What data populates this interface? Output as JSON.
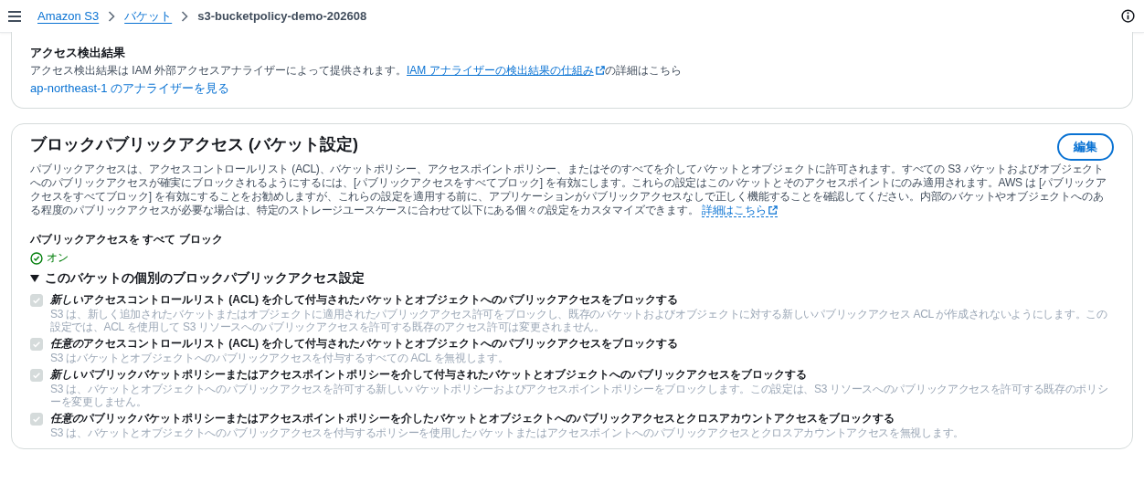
{
  "top_bar": {
    "breadcrumbs": [
      {
        "label": "Amazon S3",
        "link": true
      },
      {
        "label": "バケット",
        "link": true
      },
      {
        "label": "s3-bucketpolicy-demo-202608",
        "link": false
      }
    ]
  },
  "access_findings": {
    "title": "アクセス検出結果",
    "text_before": "アクセス検出結果は IAM 外部アクセスアナライザーによって提供されます。",
    "link": "IAM アナライザーの検出結果の仕組み",
    "text_after": "の詳細はこちら",
    "analyzer_link": "ap-northeast-1 のアナライザーを見る"
  },
  "block_public_access": {
    "title": "ブロックパブリックアクセス (バケット設定)",
    "edit_button": "編集",
    "description": "パブリックアクセスは、アクセスコントロールリスト (ACL)、バケットポリシー、アクセスポイントポリシー、またはそのすべてを介してバケットとオブジェクトに許可されます。すべての S3 バケットおよびオブジェクトへのパブリックアクセスが確実にブロックされるようにするには、[パブリックアクセスをすべてブロック] を有効にします。これらの設定はこのバケットとそのアクセスポイントにのみ適用されます。AWS は [パブリックアクセスをすべてブロック] を有効にすることをお勧めしますが、これらの設定を適用する前に、アプリケーションがパブリックアクセスなしで正しく機能することを確認してください。内部のバケットやオブジェクトへのある程度のパブリックアクセスが必要な場合は、特定のストレージユースケースに合わせて以下にある個々の設定をカスタマイズできます。",
    "learn_more": "詳細はこちら",
    "block_all": {
      "label": "パブリックアクセスを すべて ブロック",
      "status": "オン",
      "on": true
    },
    "individual": {
      "title": "このバケットの個別のブロックパブリックアクセス設定",
      "expanded": true,
      "settings": [
        {
          "emphasis": "新しい",
          "title": "アクセスコントロールリスト (ACL) を介して付与されたバケットとオブジェクトへのパブリックアクセスをブロックする",
          "description": "S3 は、新しく追加されたバケットまたはオブジェクトに適用されたパブリックアクセス許可をブロックし、既存のバケットおよびオブジェクトに対する新しいパブリックアクセス ACL が作成されないようにします。この設定では、ACL を使用して S3 リソースへのパブリックアクセスを許可する既存のアクセス許可は変更されません。",
          "checked": true,
          "disabled": true
        },
        {
          "emphasis": "任意の",
          "title": "アクセスコントロールリスト (ACL) を介して付与されたバケットとオブジェクトへのパブリックアクセスをブロックする",
          "description": "S3 はバケットとオブジェクトへのパブリックアクセスを付与するすべての ACL を無視します。",
          "checked": true,
          "disabled": true
        },
        {
          "emphasis": "新しい",
          "title": "パブリックバケットポリシーまたはアクセスポイントポリシーを介して付与されたバケットとオブジェクトへのパブリックアクセスをブロックする",
          "description": "S3 は、バケットとオブジェクトへのパブリックアクセスを許可する新しいバケットポリシーおよびアクセスポイントポリシーをブロックします。この設定は、S3 リソースへのパブリックアクセスを許可する既存のポリシーを変更しません。",
          "checked": true,
          "disabled": true
        },
        {
          "emphasis": "任意の",
          "title": "パブリックバケットポリシーまたはアクセスポイントポリシーを介したバケットとオブジェクトへのパブリックアクセスとクロスアカウントアクセスをブロックする",
          "description": "S3 は、バケットとオブジェクトへのパブリックアクセスを付与するポリシーを使用したバケットまたはアクセスポイントへのパブリックアクセスとクロスアカウントアクセスを無視します。",
          "checked": true,
          "disabled": true
        }
      ]
    }
  }
}
